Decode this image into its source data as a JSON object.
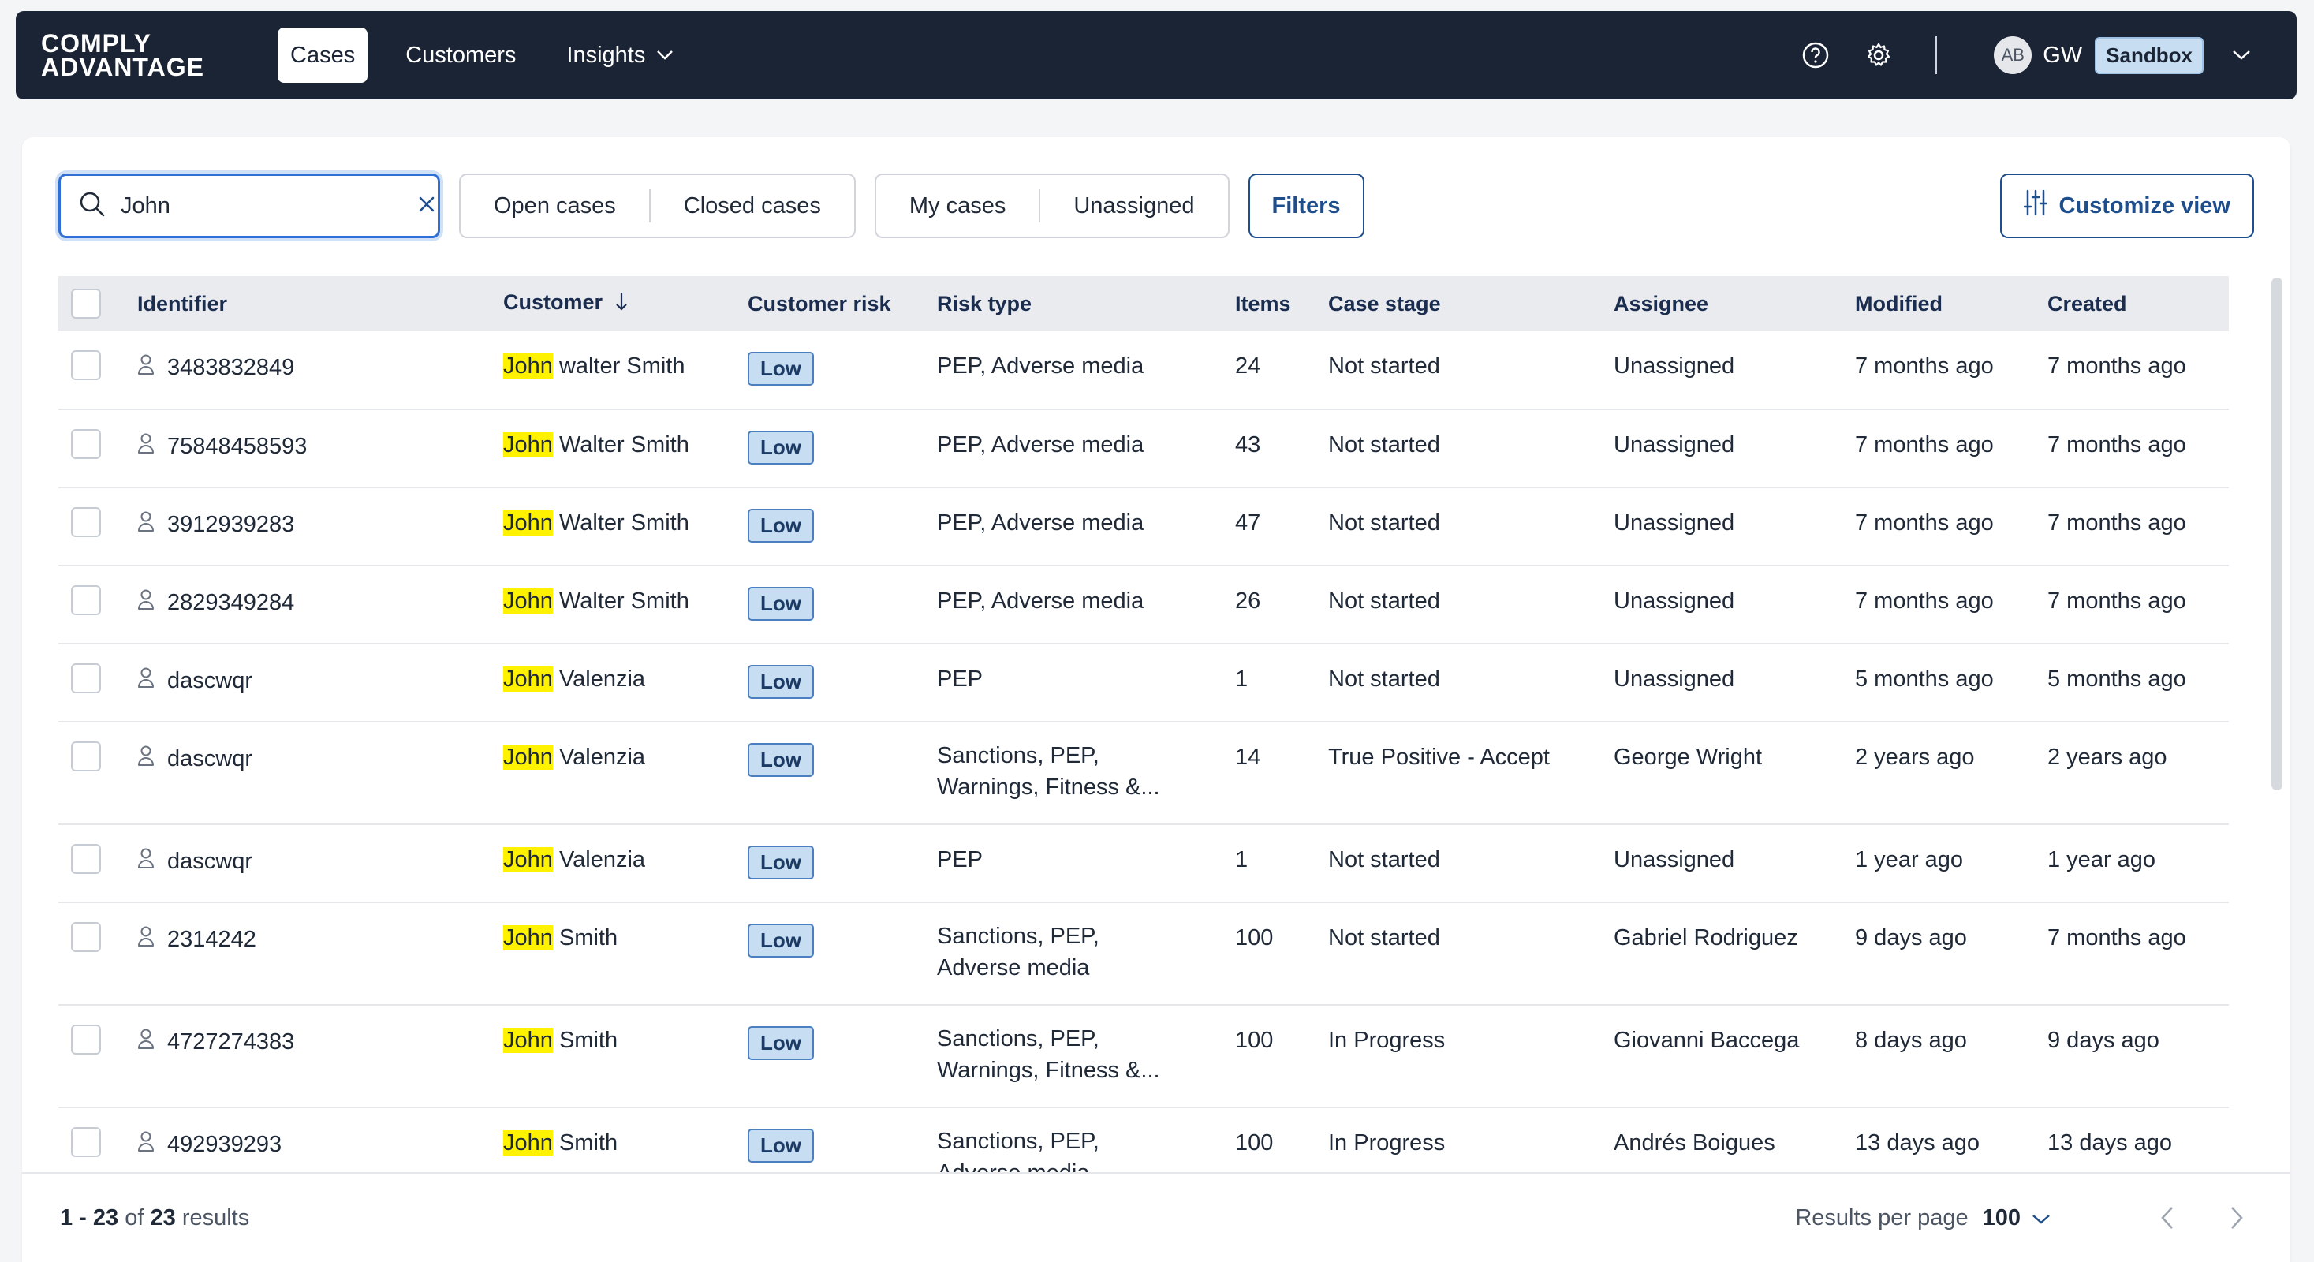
{
  "brand": {
    "line1": "COMPLY",
    "line2": "ADVANTAGE"
  },
  "nav": {
    "items": [
      {
        "label": "Cases",
        "active": true
      },
      {
        "label": "Customers",
        "active": false
      },
      {
        "label": "Insights",
        "active": false,
        "dropdown": true
      }
    ],
    "help_icon": "question-circle-icon",
    "settings_icon": "gear-icon",
    "user": {
      "avatar_initials": "AB",
      "initials": "GW",
      "environment": "Sandbox"
    }
  },
  "toolbar": {
    "search": {
      "value": "John",
      "placeholder": ""
    },
    "status_filters": [
      "Open cases",
      "Closed cases"
    ],
    "assignee_filters": [
      "My cases",
      "Unassigned"
    ],
    "filters_label": "Filters",
    "customize_label": "Customize view"
  },
  "table": {
    "columns": [
      "Identifier",
      "Customer",
      "Customer risk",
      "Risk type",
      "Items",
      "Case stage",
      "Assignee",
      "Modified",
      "Created"
    ],
    "sorted_column": "Customer",
    "sort_direction": "descending",
    "search_highlight": "John",
    "rows": [
      {
        "identifier": "3483832849",
        "customer_rest": " walter Smith",
        "risk": "Low",
        "risk_type": "PEP, Adverse media",
        "items": "24",
        "stage": "Not started",
        "assignee": "Unassigned",
        "modified": "7 months ago",
        "created": "7 months ago"
      },
      {
        "identifier": "75848458593",
        "customer_rest": " Walter Smith",
        "risk": "Low",
        "risk_type": "PEP, Adverse media",
        "items": "43",
        "stage": "Not started",
        "assignee": "Unassigned",
        "modified": "7 months ago",
        "created": "7 months ago"
      },
      {
        "identifier": "3912939283",
        "customer_rest": " Walter Smith",
        "risk": "Low",
        "risk_type": "PEP, Adverse media",
        "items": "47",
        "stage": "Not started",
        "assignee": "Unassigned",
        "modified": "7 months ago",
        "created": "7 months ago"
      },
      {
        "identifier": "2829349284",
        "customer_rest": " Walter Smith",
        "risk": "Low",
        "risk_type": "PEP, Adverse media",
        "items": "26",
        "stage": "Not started",
        "assignee": "Unassigned",
        "modified": "7 months ago",
        "created": "7 months ago"
      },
      {
        "identifier": "dascwqr",
        "customer_rest": " Valenzia",
        "risk": "Low",
        "risk_type": "PEP",
        "items": "1",
        "stage": "Not started",
        "assignee": "Unassigned",
        "modified": "5 months ago",
        "created": "5 months ago"
      },
      {
        "identifier": "dascwqr",
        "customer_rest": " Valenzia",
        "risk": "Low",
        "risk_type_l1": "Sanctions, PEP,",
        "risk_type_l2": "Warnings, Fitness &...",
        "items": "14",
        "stage": "True Positive - Accept",
        "assignee": "George Wright",
        "modified": "2 years ago",
        "created": "2 years ago"
      },
      {
        "identifier": "dascwqr",
        "customer_rest": " Valenzia",
        "risk": "Low",
        "risk_type": "PEP",
        "items": "1",
        "stage": "Not started",
        "assignee": "Unassigned",
        "modified": "1 year ago",
        "created": "1 year ago"
      },
      {
        "identifier": "2314242",
        "customer_rest": " Smith",
        "risk": "Low",
        "risk_type_l1": "Sanctions, PEP,",
        "risk_type_l2": "Adverse media",
        "items": "100",
        "stage": "Not started",
        "assignee": "Gabriel Rodriguez",
        "modified": "9 days ago",
        "created": "7 months ago"
      },
      {
        "identifier": "4727274383",
        "customer_rest": " Smith",
        "risk": "Low",
        "risk_type_l1": "Sanctions, PEP,",
        "risk_type_l2": "Warnings, Fitness &...",
        "items": "100",
        "stage": "In Progress",
        "assignee": "Giovanni Baccega",
        "modified": "8 days ago",
        "created": "9 days ago"
      },
      {
        "identifier": "492939293",
        "customer_rest": " Smith",
        "risk": "Low",
        "risk_type_l1": "Sanctions, PEP,",
        "risk_type_l2": "Adverse media",
        "items": "100",
        "stage": "In Progress",
        "assignee": "Andrés Boigues",
        "modified": "13 days ago",
        "created": "13 days ago"
      }
    ]
  },
  "footer": {
    "range": "1 - 23",
    "of_label": "of",
    "total": "23",
    "results_label": "results",
    "per_page_label": "Results per page",
    "per_page_value": "100"
  },
  "colors": {
    "nav_bg": "#1b2434",
    "accent": "#1f4e8c",
    "search_focus": "#2f6fd6",
    "highlight": "#fff200",
    "risk_low_bg": "#c7ddf1"
  }
}
